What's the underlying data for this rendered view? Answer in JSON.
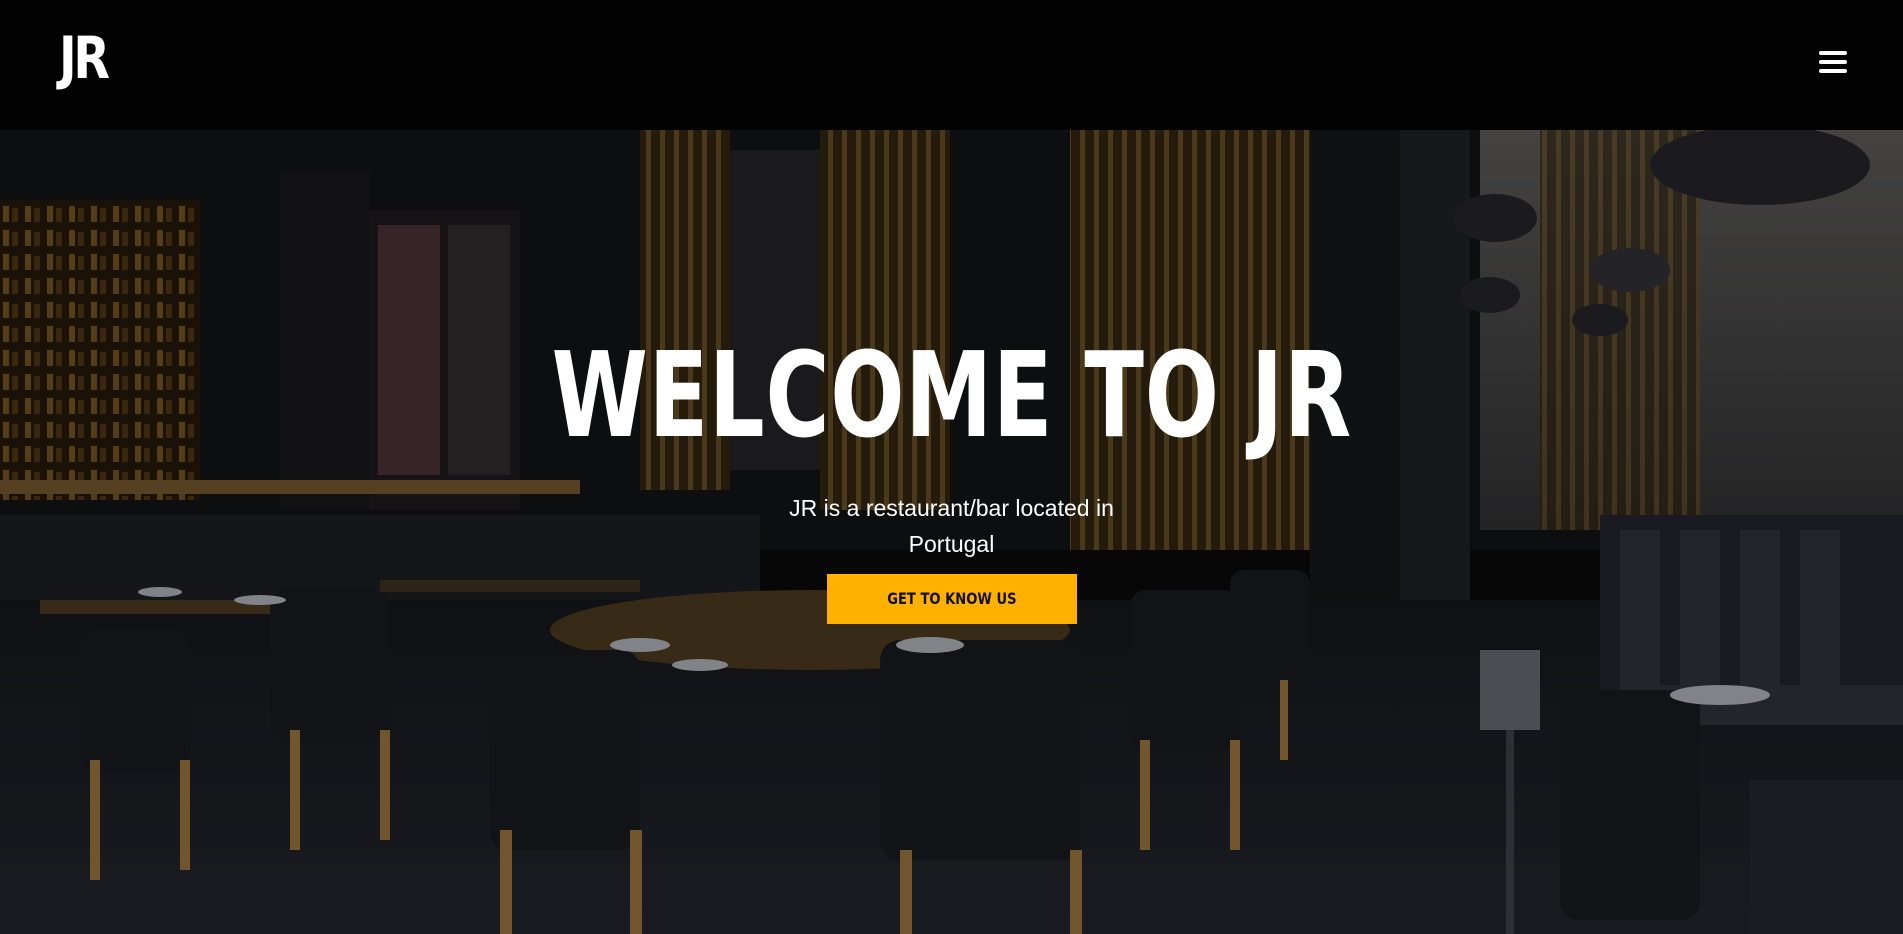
{
  "header": {
    "logo_text": "JR",
    "menu_icon": "hamburger-menu-icon"
  },
  "hero": {
    "title": "WELCOME TO JR",
    "subtitle": "JR is a restaurant/bar located in Portugal",
    "cta_label": "GET TO KNOW US",
    "background_image": "restaurant interior photograph"
  },
  "colors": {
    "accent": "#ffb000",
    "nav_background": "#020202",
    "text": "#ffffff"
  }
}
